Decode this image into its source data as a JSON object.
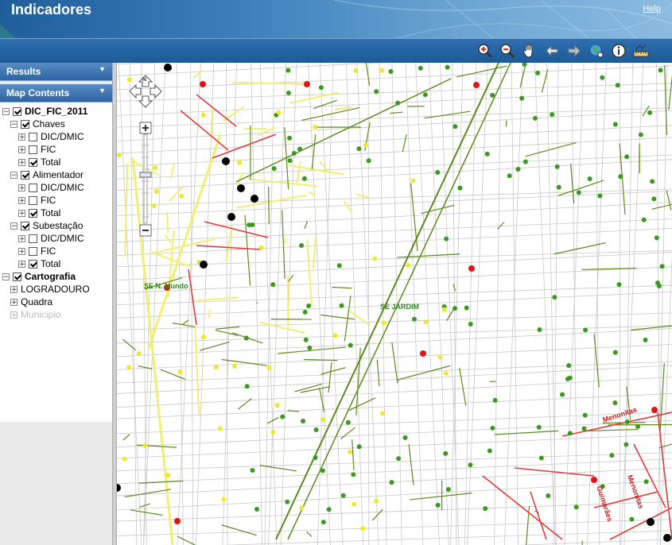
{
  "app": {
    "title": "Indicadores",
    "help": "Help"
  },
  "toolbar": {
    "tools": [
      "zoom-in-icon",
      "zoom-out-icon",
      "pan-hand-icon",
      "back-arrow-icon",
      "forward-arrow-icon",
      "full-extent-globe-icon",
      "identify-info-icon",
      "measure-ruler-icon"
    ]
  },
  "panel": {
    "results": "Results",
    "map_contents": "Map Contents"
  },
  "toc": {
    "root": "DIC_FIC_2011",
    "chaves": "Chaves",
    "alimentador": "Alimentador",
    "subestacao": "Subestação",
    "dic_dmic": "DIC/DMIC",
    "fic": "FIC",
    "total": "Total",
    "cartografia": "Cartografia",
    "logradouro": "LOGRADOURO",
    "quadra": "Quadra",
    "municipio": "Municipio"
  },
  "map": {
    "labels": {
      "se_nm": "SE N. Mundo",
      "se_jd": "SE JARDIM",
      "menonitas1": "Menonitas",
      "menonitas2": "Menonitas",
      "guimaraes": "Guimarães"
    },
    "nav": {
      "north": "N"
    },
    "colors": {
      "green_line": "#5c8a1e",
      "yellow_line": "#f2ee74",
      "red_line": "#e23a3a",
      "street": "#c8c8c8"
    }
  }
}
